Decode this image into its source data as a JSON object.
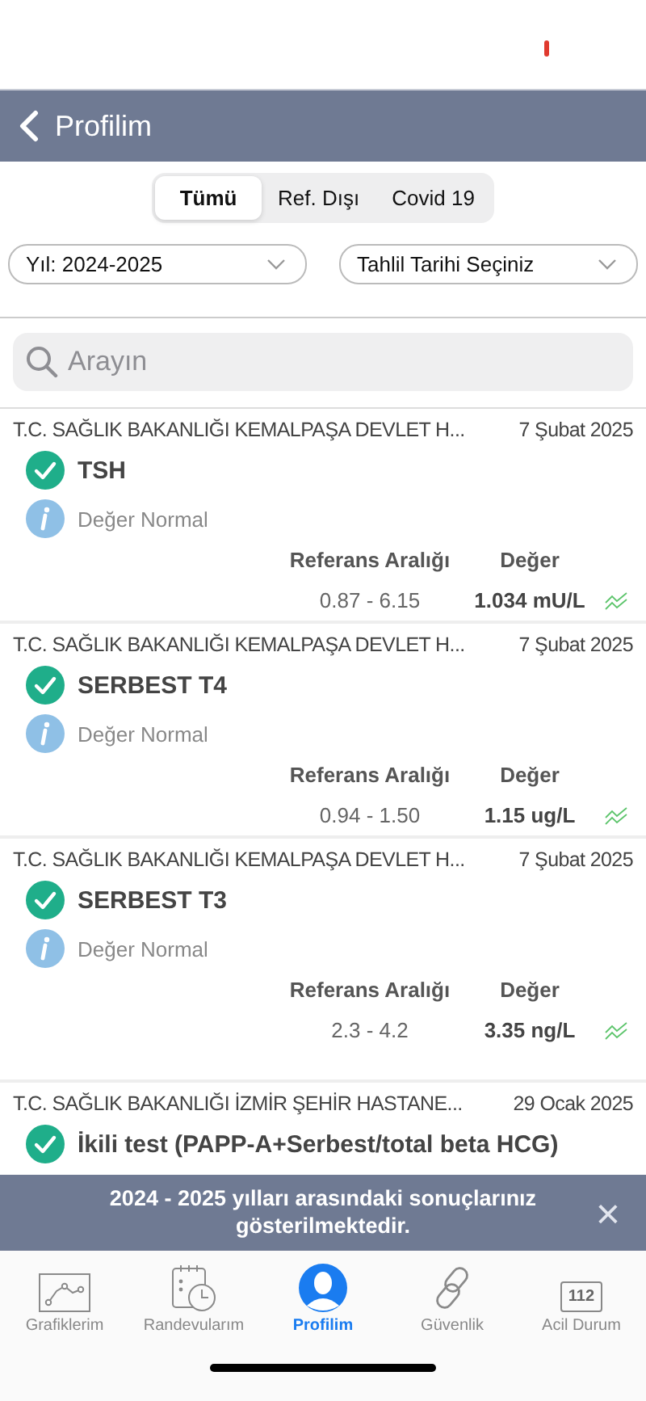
{
  "nav": {
    "title": "Profilim"
  },
  "segments": [
    {
      "label": "Tümü",
      "selected": true
    },
    {
      "label": "Ref. Dışı",
      "selected": false
    },
    {
      "label": "Covid 19",
      "selected": false
    }
  ],
  "filters": [
    {
      "value": "Yıl: 2024-2025"
    },
    {
      "value": "Tahlil Tarihi Seçiniz"
    }
  ],
  "search": {
    "placeholder": "Arayın"
  },
  "results": [
    {
      "hospital": "T.C. SAĞLIK BAKANLIĞI KEMALPAŞA DEVLET H...",
      "date": "7 Şubat 2025",
      "test": "TSH",
      "kind": "normal",
      "note": "Değer Normal",
      "ref_label": "Referans Aralığı",
      "value_label": "Değer",
      "ref_range": "0.87 - 6.15",
      "value": "1.034 mU/L"
    },
    {
      "hospital": "T.C. SAĞLIK BAKANLIĞI KEMALPAŞA DEVLET H...",
      "date": "7 Şubat 2025",
      "test": "SERBEST T4",
      "kind": "normal",
      "note": "Değer Normal",
      "ref_label": "Referans Aralığı",
      "value_label": "Değer",
      "ref_range": "0.94 - 1.50",
      "value": "1.15 ug/L"
    },
    {
      "hospital": "T.C. SAĞLIK BAKANLIĞI KEMALPAŞA DEVLET H...",
      "date": "7 Şubat 2025",
      "test": "SERBEST T3",
      "kind": "normal",
      "note": "Değer Normal",
      "ref_label": "Referans Aralığı",
      "value_label": "Değer",
      "ref_range": "2.3 - 4.2",
      "value": "3.35 ng/L"
    },
    {
      "hospital": "T.C. SAĞLIK BAKANLIĞI İZMİR ŞEHİR HASTANE...",
      "date": "29 Ocak 2025",
      "test": "İkili test (PAPP-A+Serbest/total beta HCG)",
      "kind": "normal"
    }
  ],
  "banner": {
    "message": "2024 - 2025 yılları arasındaki sonuçlarınız gösterilmektedir.",
    "close_icon": "×"
  },
  "tabbar": [
    {
      "kind": "chart",
      "label": "Grafiklerim",
      "selected": false
    },
    {
      "kind": "calendar",
      "label": "Randevularım",
      "selected": false
    },
    {
      "kind": "profile",
      "label": "Profilim",
      "selected": true
    },
    {
      "kind": "link",
      "label": "Güvenlik",
      "selected": false
    },
    {
      "kind": "emergency",
      "label": "Acil Durum",
      "badge": "112",
      "selected": false
    }
  ]
}
